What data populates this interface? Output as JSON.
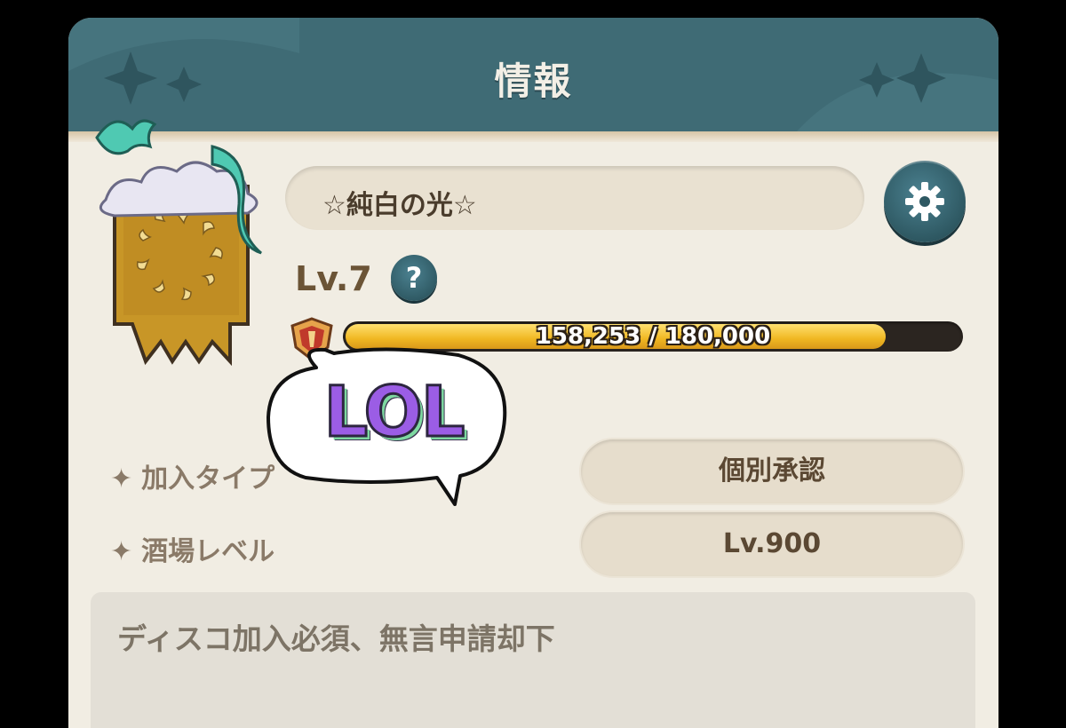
{
  "header": {
    "title": "情報"
  },
  "guild": {
    "name": "☆純白の光☆",
    "level": "Lv.7",
    "help_label": "?",
    "xp": {
      "current": 158253,
      "max": 180000,
      "label": "158,253 / 180,000",
      "fill_fraction": 0.88
    }
  },
  "rows": [
    {
      "label": "加入タイプ",
      "value": "個別承認"
    },
    {
      "label": "酒場レベル",
      "value": "Lv.900"
    }
  ],
  "description": "ディスコ加入必須、無言申請却下",
  "overlay": {
    "bubble_text": "LOL"
  },
  "icons": [
    "star-icon",
    "gear-icon",
    "question-icon",
    "shield-icon",
    "guild-emblem-icon"
  ],
  "colors": {
    "header": "#3f6b75",
    "panel": "#f1ede3",
    "xp_fill": "#f0b722",
    "bubble_text": "#9b5de5"
  }
}
